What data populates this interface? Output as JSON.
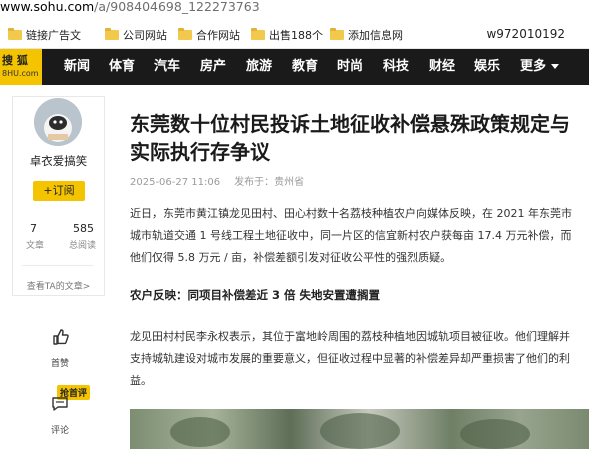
{
  "browser": {
    "url_host": "www.sohu.com",
    "url_path": "/a/908404698_122273763"
  },
  "bookmarks": {
    "items": [
      "链接广告文",
      "公司网站",
      "合作网站",
      "出售188个",
      "添加信息网"
    ],
    "user": "w972010192"
  },
  "nav": {
    "logo_main": "搜 狐",
    "logo_sub": "8HU.com",
    "items": [
      "新闻",
      "体育",
      "汽车",
      "房产",
      "旅游",
      "教育",
      "时尚",
      "科技",
      "财经",
      "娱乐",
      "更多"
    ]
  },
  "author": {
    "name": "卓衣爱搞笑",
    "follow_label": "+订阅",
    "articles_count": "7",
    "articles_label": "文章",
    "reads_count": "585",
    "reads_label": "总阅读",
    "see_all": "查看TA的文章>"
  },
  "actions": {
    "like_label": "首赞",
    "comment_badge": "抢首评",
    "comment_label": "评论"
  },
  "article": {
    "title_line1": "东莞数十位村民投诉土地征收补偿悬殊政策规定与",
    "title_line2": "实际执行存争议",
    "date": "2025-06-27 11:06",
    "location": "发布于：贵州省",
    "p1_line1": "近日，东莞市黄江镇龙见田村、田心村数十名荔枝种植农户向媒体反映，在 2021 年东莞市",
    "p1_line2": "城市轨道交通 1 号线工程土地征收中，同一片区的信宜新村农户获每亩 17.4 万元补偿，而",
    "p1_line3": "他们仅得 5.8 万元 / 亩，补偿差额引发对征收公平性的强烈质疑。",
    "subheading": "农户反映：同项目补偿差近 3 倍 失地安置遭搁置",
    "p2_line1": "龙见田村村民李永权表示，其位于富地岭周围的荔枝种植地因城轨项目被征收。他们理解并",
    "p2_line2": "支持城轨建设对城市发展的重要意义，但征收过程中显著的补偿差异却严重损害了他们的利",
    "p2_line3": "益。"
  }
}
